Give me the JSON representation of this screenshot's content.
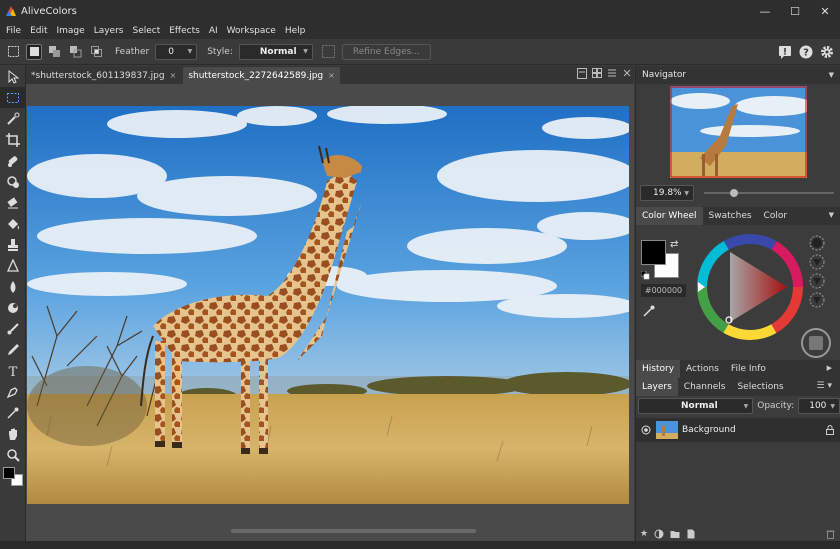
{
  "app": {
    "title": "AliveColors"
  },
  "window_controls": {
    "minimize": "—",
    "maximize": "☐",
    "close": "✕"
  },
  "menu": [
    "File",
    "Edit",
    "Image",
    "Layers",
    "Select",
    "Effects",
    "AI",
    "Workspace",
    "Help"
  ],
  "options": {
    "feather_label": "Feather",
    "feather_value": "0",
    "style_label": "Style:",
    "style_value": "Normal",
    "refine_label": "Refine Edges..."
  },
  "tabs": [
    {
      "label": "*shutterstock_601139837.jpg",
      "close": "×"
    },
    {
      "label": "shutterstock_2272642589.jpg",
      "close": "×"
    }
  ],
  "navigator": {
    "title": "Navigator",
    "zoom": "19.8%"
  },
  "color_panel": {
    "tabs": [
      "Color Wheel",
      "Swatches",
      "Color"
    ],
    "hex": "#000000",
    "foreground": "#000000",
    "background": "#ffffff"
  },
  "history_panel": {
    "tabs": [
      "History",
      "Actions",
      "File Info"
    ]
  },
  "layers_panel": {
    "tabs": [
      "Layers",
      "Channels",
      "Selections"
    ],
    "blend_mode": "Normal",
    "opacity_label": "Opacity:",
    "opacity_value": "100",
    "layers": [
      {
        "name": "Background"
      }
    ]
  }
}
